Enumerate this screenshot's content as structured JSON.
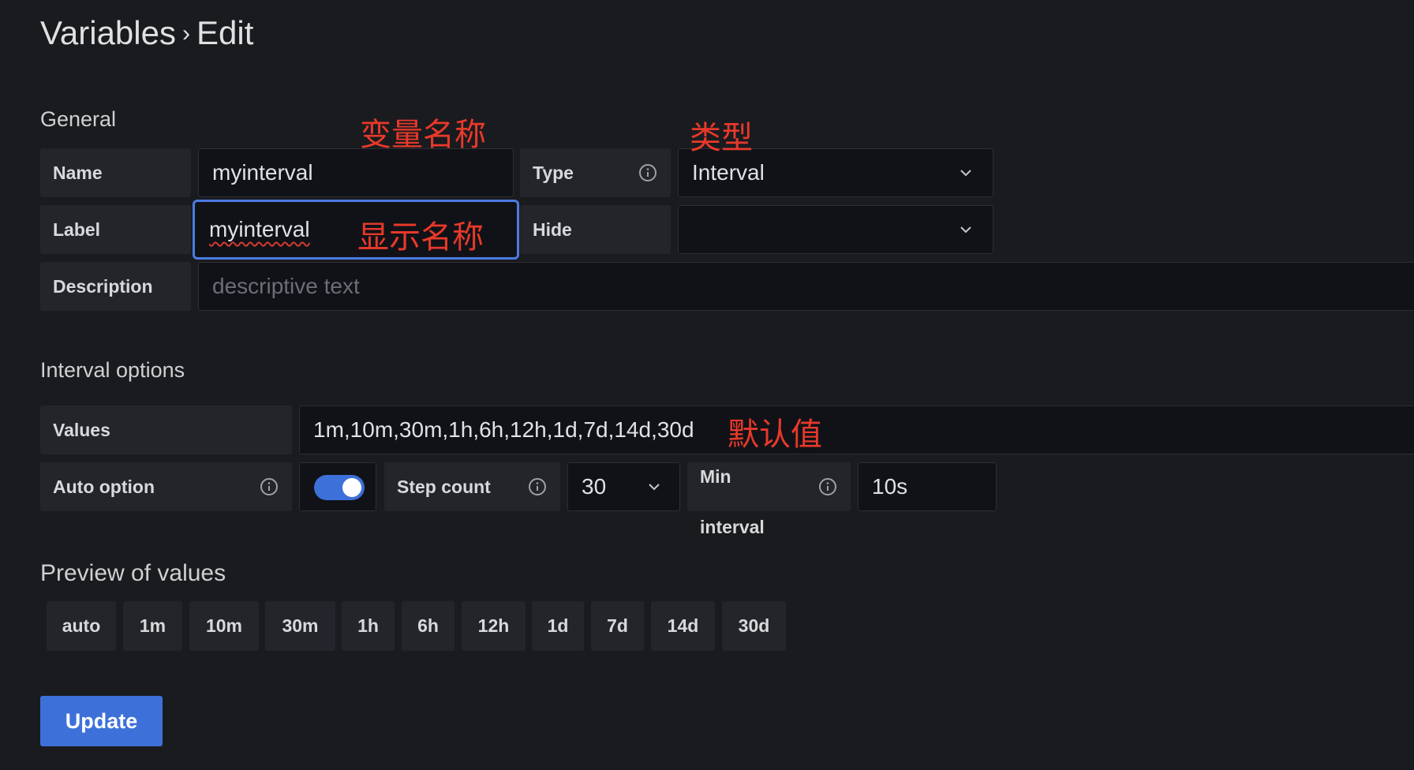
{
  "header": {
    "breadcrumb_parent": "Variables",
    "separator": "›",
    "breadcrumb_current": "Edit"
  },
  "general": {
    "section_title": "General",
    "name_label": "Name",
    "name_value": "myinterval",
    "type_label": "Type",
    "type_value": "Interval",
    "label_label": "Label",
    "label_value": "myinterval",
    "hide_label": "Hide",
    "hide_value": "",
    "description_label": "Description",
    "description_placeholder": "descriptive text"
  },
  "interval_options": {
    "section_title": "Interval options",
    "values_label": "Values",
    "values_value": "1m,10m,30m,1h,6h,12h,1d,7d,14d,30d",
    "auto_option_label": "Auto option",
    "auto_option_enabled": true,
    "step_count_label": "Step count",
    "step_count_value": "30",
    "min_interval_label_line1": "Min",
    "min_interval_label_line2": "interval",
    "min_interval_value": "10s"
  },
  "preview": {
    "section_title": "Preview of values",
    "chips": [
      "auto",
      "1m",
      "10m",
      "30m",
      "1h",
      "6h",
      "12h",
      "1d",
      "7d",
      "14d",
      "30d"
    ]
  },
  "update_button": "Update",
  "annotations": {
    "name": "变量名称",
    "type": "类型",
    "label": "显示名称",
    "default": "默认值"
  },
  "colors": {
    "background": "#1a1b1f",
    "label_bg": "#23252b",
    "input_bg": "#111217",
    "accent_blue": "#3d71d9",
    "focus_border": "#4b7ae3",
    "annotation_red": "#e8392a"
  },
  "icons": {
    "info": "info-circle-icon",
    "chevron": "chevron-down-icon"
  }
}
